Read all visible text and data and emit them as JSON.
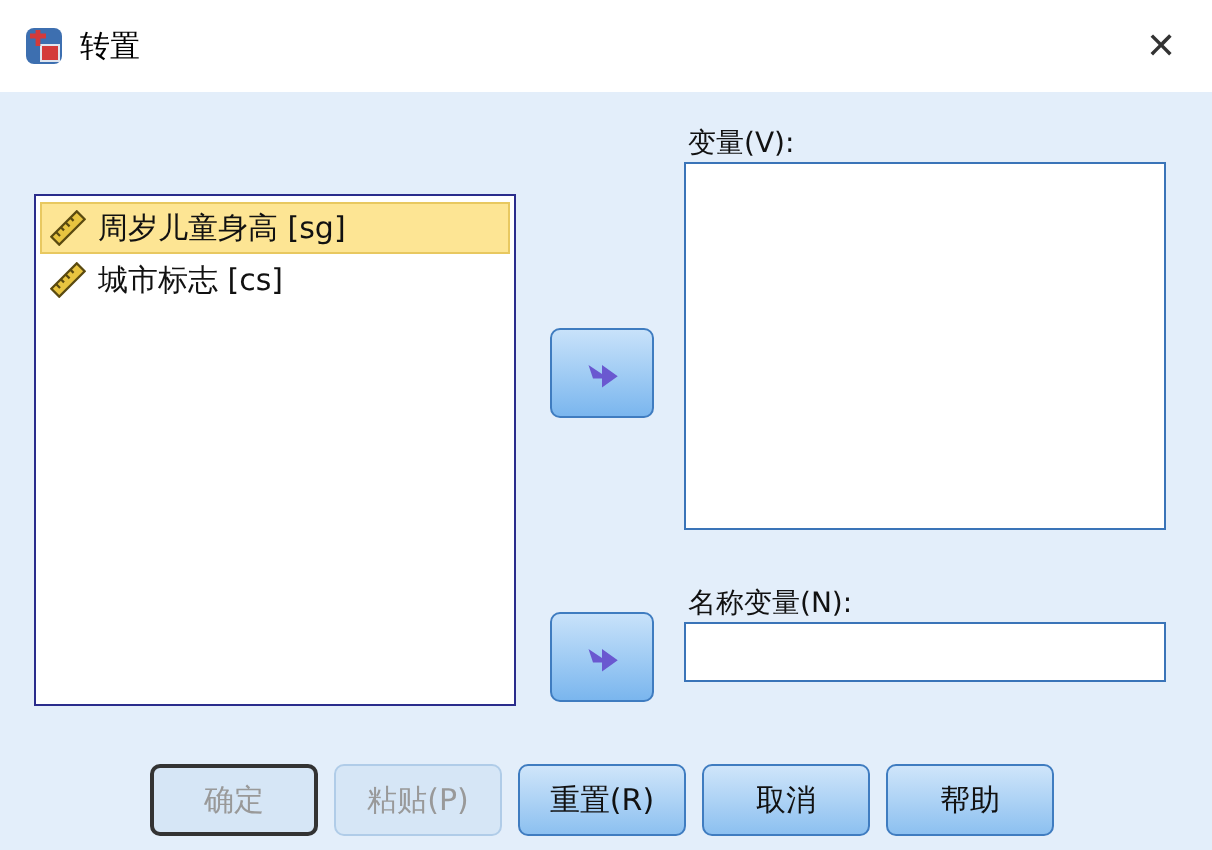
{
  "window": {
    "title": "转置",
    "close": "✕"
  },
  "source_list": {
    "items": [
      {
        "label": "周岁儿童身高 [sg]",
        "selected": true
      },
      {
        "label": "城市标志 [cs]",
        "selected": false
      }
    ]
  },
  "variables": {
    "label": "变量(V):"
  },
  "name_variable": {
    "label": "名称变量(N):"
  },
  "buttons": [
    {
      "label": "确定",
      "disabled": true,
      "default": true
    },
    {
      "label": "粘贴(P)",
      "disabled": true,
      "default": false
    },
    {
      "label": "重置(R)",
      "disabled": false,
      "default": false
    },
    {
      "label": "取消",
      "disabled": false,
      "default": false
    },
    {
      "label": "帮助",
      "disabled": false,
      "default": false
    }
  ]
}
